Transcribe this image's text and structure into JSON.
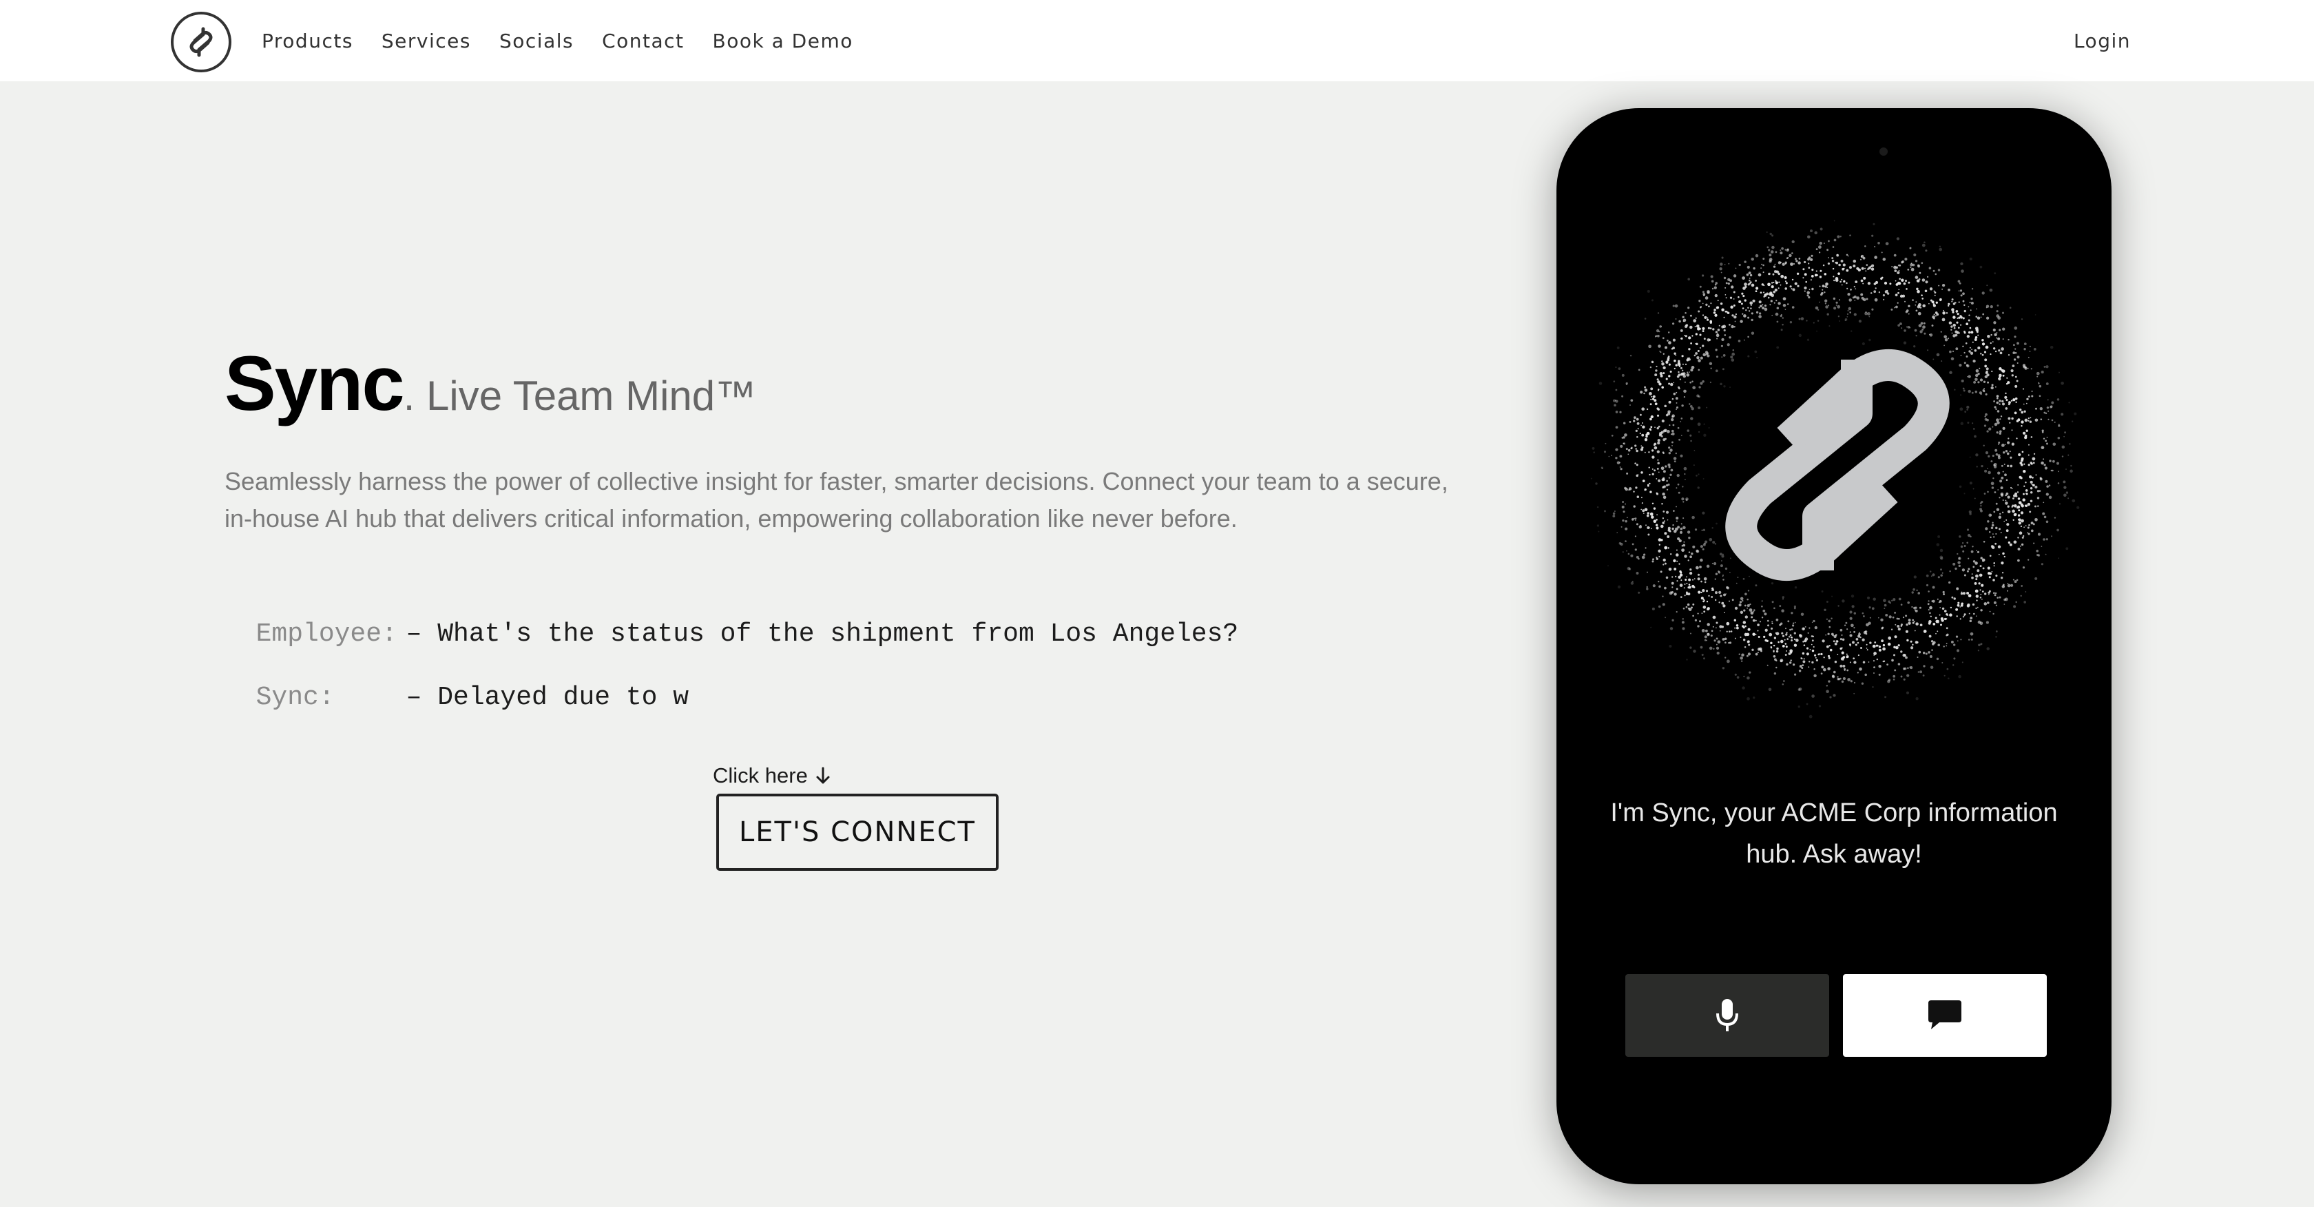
{
  "nav": {
    "logo_icon": "sync-s-logo-icon",
    "items": [
      {
        "label": "Products"
      },
      {
        "label": "Services"
      },
      {
        "label": "Socials"
      },
      {
        "label": "Contact"
      },
      {
        "label": "Book a Demo"
      }
    ],
    "login_label": "Login"
  },
  "hero": {
    "brand": "Sync",
    "tagline": ". Live Team Mind™",
    "description": "Seamlessly harness the power of collective insight for faster, smarter decisions. Connect your team to a secure, in-house AI hub that delivers critical information, empowering collaboration like never before.",
    "conversation": [
      {
        "speaker": "Employee:",
        "message": "– What's the status of the shipment from Los Angeles?"
      },
      {
        "speaker": "Sync:",
        "message": "– Delayed due to w"
      }
    ],
    "click_hint": "Click here",
    "click_hint_icon": "arrow-down-icon",
    "cta_label": "LET'S CONNECT"
  },
  "phone": {
    "intro": "I'm Sync, your ACME Corp information hub. Ask away!",
    "mic_icon": "microphone-icon",
    "chat_icon": "chat-bubble-icon"
  },
  "colors": {
    "page_bg": "#f0f1ef",
    "phone_bg": "#000000",
    "mic_button_bg": "#2b2c2a",
    "chat_button_bg": "#ffffff"
  }
}
